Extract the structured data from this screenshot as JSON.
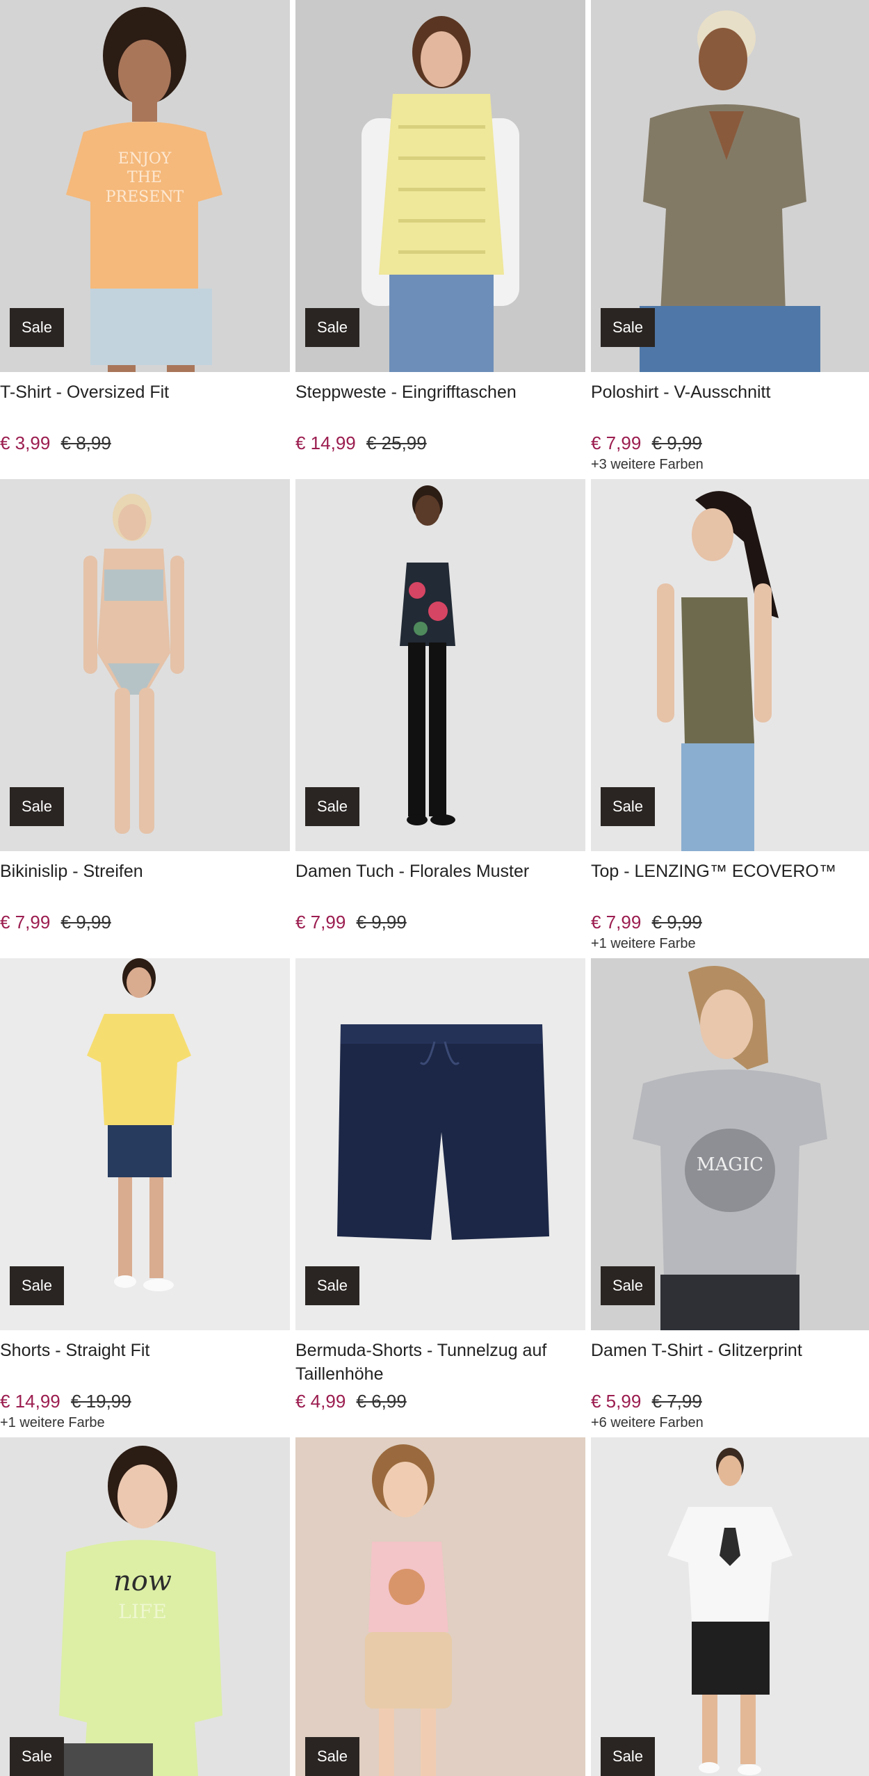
{
  "sale_label": "Sale",
  "colors": {
    "price": "#9b1d4f",
    "badge_bg": "#2a2522"
  },
  "products": [
    {
      "title": "T-Shirt - Oversized Fit",
      "price": "€ 3,99",
      "old_price": "€ 8,99",
      "more_colors": ""
    },
    {
      "title": "Steppweste - Eingrifftaschen",
      "price": "€ 14,99",
      "old_price": "€ 25,99",
      "more_colors": ""
    },
    {
      "title": "Poloshirt - V-Ausschnitt",
      "price": "€ 7,99",
      "old_price": "€ 9,99",
      "more_colors": "+3 weitere Farben"
    },
    {
      "title": "Bikinislip - Streifen",
      "price": "€ 7,99",
      "old_price": "€ 9,99",
      "more_colors": ""
    },
    {
      "title": "Damen Tuch - Florales Muster",
      "price": "€ 7,99",
      "old_price": "€ 9,99",
      "more_colors": ""
    },
    {
      "title": "Top - LENZING™ ECOVERO™",
      "price": "€ 7,99",
      "old_price": "€ 9,99",
      "more_colors": "+1 weitere Farbe"
    },
    {
      "title": "Shorts - Straight Fit",
      "price": "€ 14,99",
      "old_price": "€ 19,99",
      "more_colors": "+1 weitere Farbe"
    },
    {
      "title": "Bermuda-Shorts - Tunnelzug auf Taillenhöhe",
      "price": "€ 4,99",
      "old_price": "€ 6,99",
      "more_colors": ""
    },
    {
      "title": "Damen T-Shirt - Glitzerprint",
      "price": "€ 5,99",
      "old_price": "€ 7,99",
      "more_colors": "+6 weitere Farben"
    },
    {
      "title": "",
      "price": "",
      "old_price": "",
      "more_colors": ""
    },
    {
      "title": "",
      "price": "",
      "old_price": "",
      "more_colors": ""
    },
    {
      "title": "",
      "price": "",
      "old_price": "",
      "more_colors": ""
    }
  ]
}
